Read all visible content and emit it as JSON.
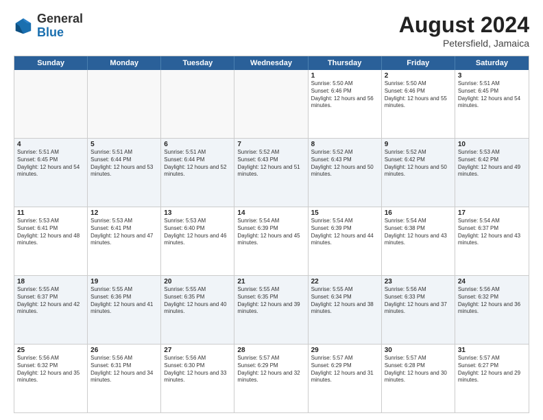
{
  "logo": {
    "general": "General",
    "blue": "Blue"
  },
  "header": {
    "month_year": "August 2024",
    "location": "Petersfield, Jamaica"
  },
  "days_of_week": [
    "Sunday",
    "Monday",
    "Tuesday",
    "Wednesday",
    "Thursday",
    "Friday",
    "Saturday"
  ],
  "weeks": [
    [
      {
        "day": "",
        "empty": true
      },
      {
        "day": "",
        "empty": true
      },
      {
        "day": "",
        "empty": true
      },
      {
        "day": "",
        "empty": true
      },
      {
        "day": "1",
        "sunrise": "Sunrise: 5:50 AM",
        "sunset": "Sunset: 6:46 PM",
        "daylight": "Daylight: 12 hours and 56 minutes."
      },
      {
        "day": "2",
        "sunrise": "Sunrise: 5:50 AM",
        "sunset": "Sunset: 6:46 PM",
        "daylight": "Daylight: 12 hours and 55 minutes."
      },
      {
        "day": "3",
        "sunrise": "Sunrise: 5:51 AM",
        "sunset": "Sunset: 6:45 PM",
        "daylight": "Daylight: 12 hours and 54 minutes."
      }
    ],
    [
      {
        "day": "4",
        "sunrise": "Sunrise: 5:51 AM",
        "sunset": "Sunset: 6:45 PM",
        "daylight": "Daylight: 12 hours and 54 minutes."
      },
      {
        "day": "5",
        "sunrise": "Sunrise: 5:51 AM",
        "sunset": "Sunset: 6:44 PM",
        "daylight": "Daylight: 12 hours and 53 minutes."
      },
      {
        "day": "6",
        "sunrise": "Sunrise: 5:51 AM",
        "sunset": "Sunset: 6:44 PM",
        "daylight": "Daylight: 12 hours and 52 minutes."
      },
      {
        "day": "7",
        "sunrise": "Sunrise: 5:52 AM",
        "sunset": "Sunset: 6:43 PM",
        "daylight": "Daylight: 12 hours and 51 minutes."
      },
      {
        "day": "8",
        "sunrise": "Sunrise: 5:52 AM",
        "sunset": "Sunset: 6:43 PM",
        "daylight": "Daylight: 12 hours and 50 minutes."
      },
      {
        "day": "9",
        "sunrise": "Sunrise: 5:52 AM",
        "sunset": "Sunset: 6:42 PM",
        "daylight": "Daylight: 12 hours and 50 minutes."
      },
      {
        "day": "10",
        "sunrise": "Sunrise: 5:53 AM",
        "sunset": "Sunset: 6:42 PM",
        "daylight": "Daylight: 12 hours and 49 minutes."
      }
    ],
    [
      {
        "day": "11",
        "sunrise": "Sunrise: 5:53 AM",
        "sunset": "Sunset: 6:41 PM",
        "daylight": "Daylight: 12 hours and 48 minutes."
      },
      {
        "day": "12",
        "sunrise": "Sunrise: 5:53 AM",
        "sunset": "Sunset: 6:41 PM",
        "daylight": "Daylight: 12 hours and 47 minutes."
      },
      {
        "day": "13",
        "sunrise": "Sunrise: 5:53 AM",
        "sunset": "Sunset: 6:40 PM",
        "daylight": "Daylight: 12 hours and 46 minutes."
      },
      {
        "day": "14",
        "sunrise": "Sunrise: 5:54 AM",
        "sunset": "Sunset: 6:39 PM",
        "daylight": "Daylight: 12 hours and 45 minutes."
      },
      {
        "day": "15",
        "sunrise": "Sunrise: 5:54 AM",
        "sunset": "Sunset: 6:39 PM",
        "daylight": "Daylight: 12 hours and 44 minutes."
      },
      {
        "day": "16",
        "sunrise": "Sunrise: 5:54 AM",
        "sunset": "Sunset: 6:38 PM",
        "daylight": "Daylight: 12 hours and 43 minutes."
      },
      {
        "day": "17",
        "sunrise": "Sunrise: 5:54 AM",
        "sunset": "Sunset: 6:37 PM",
        "daylight": "Daylight: 12 hours and 43 minutes."
      }
    ],
    [
      {
        "day": "18",
        "sunrise": "Sunrise: 5:55 AM",
        "sunset": "Sunset: 6:37 PM",
        "daylight": "Daylight: 12 hours and 42 minutes."
      },
      {
        "day": "19",
        "sunrise": "Sunrise: 5:55 AM",
        "sunset": "Sunset: 6:36 PM",
        "daylight": "Daylight: 12 hours and 41 minutes."
      },
      {
        "day": "20",
        "sunrise": "Sunrise: 5:55 AM",
        "sunset": "Sunset: 6:35 PM",
        "daylight": "Daylight: 12 hours and 40 minutes."
      },
      {
        "day": "21",
        "sunrise": "Sunrise: 5:55 AM",
        "sunset": "Sunset: 6:35 PM",
        "daylight": "Daylight: 12 hours and 39 minutes."
      },
      {
        "day": "22",
        "sunrise": "Sunrise: 5:55 AM",
        "sunset": "Sunset: 6:34 PM",
        "daylight": "Daylight: 12 hours and 38 minutes."
      },
      {
        "day": "23",
        "sunrise": "Sunrise: 5:56 AM",
        "sunset": "Sunset: 6:33 PM",
        "daylight": "Daylight: 12 hours and 37 minutes."
      },
      {
        "day": "24",
        "sunrise": "Sunrise: 5:56 AM",
        "sunset": "Sunset: 6:32 PM",
        "daylight": "Daylight: 12 hours and 36 minutes."
      }
    ],
    [
      {
        "day": "25",
        "sunrise": "Sunrise: 5:56 AM",
        "sunset": "Sunset: 6:32 PM",
        "daylight": "Daylight: 12 hours and 35 minutes."
      },
      {
        "day": "26",
        "sunrise": "Sunrise: 5:56 AM",
        "sunset": "Sunset: 6:31 PM",
        "daylight": "Daylight: 12 hours and 34 minutes."
      },
      {
        "day": "27",
        "sunrise": "Sunrise: 5:56 AM",
        "sunset": "Sunset: 6:30 PM",
        "daylight": "Daylight: 12 hours and 33 minutes."
      },
      {
        "day": "28",
        "sunrise": "Sunrise: 5:57 AM",
        "sunset": "Sunset: 6:29 PM",
        "daylight": "Daylight: 12 hours and 32 minutes."
      },
      {
        "day": "29",
        "sunrise": "Sunrise: 5:57 AM",
        "sunset": "Sunset: 6:29 PM",
        "daylight": "Daylight: 12 hours and 31 minutes."
      },
      {
        "day": "30",
        "sunrise": "Sunrise: 5:57 AM",
        "sunset": "Sunset: 6:28 PM",
        "daylight": "Daylight: 12 hours and 30 minutes."
      },
      {
        "day": "31",
        "sunrise": "Sunrise: 5:57 AM",
        "sunset": "Sunset: 6:27 PM",
        "daylight": "Daylight: 12 hours and 29 minutes."
      }
    ]
  ]
}
